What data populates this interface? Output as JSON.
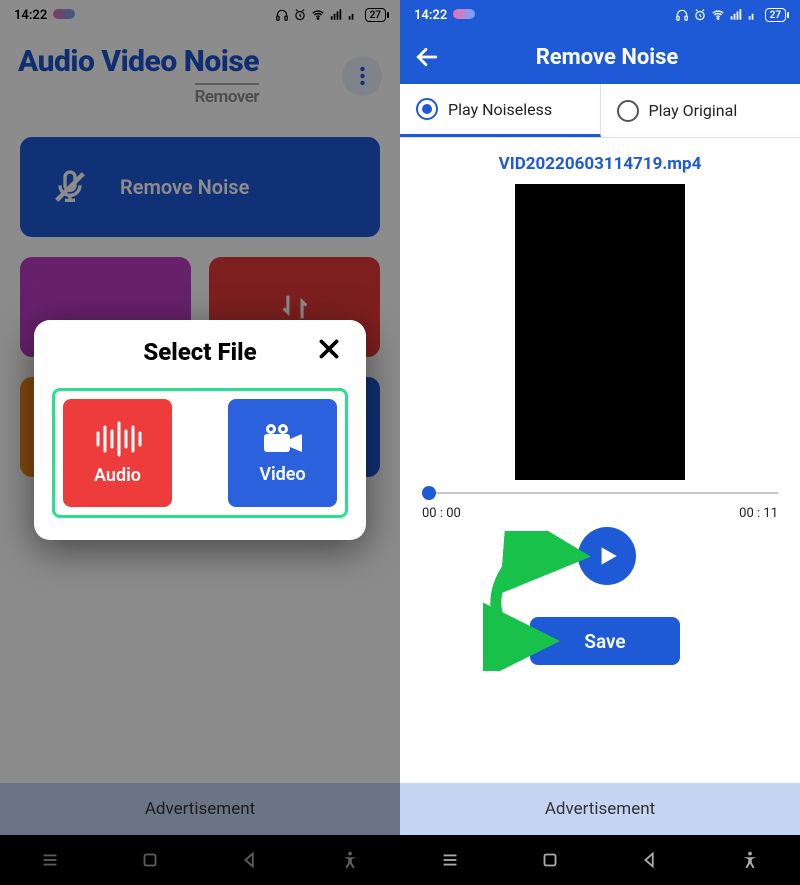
{
  "status": {
    "time": "14:22",
    "battery": "27"
  },
  "left": {
    "title_line1": "Audio Video Noise",
    "title_line2": "Remover",
    "main_button": "Remove Noise",
    "ad": "Advertisement",
    "modal": {
      "title": "Select File",
      "audio": "Audio",
      "video": "Video"
    }
  },
  "right": {
    "header": "Remove Noise",
    "tab_noiseless": "Play Noiseless",
    "tab_original": "Play Original",
    "filename": "VID20220603114719.mp4",
    "time_start": "00 : 00",
    "time_end": "00 : 11",
    "save": "Save",
    "ad": "Advertisement"
  }
}
